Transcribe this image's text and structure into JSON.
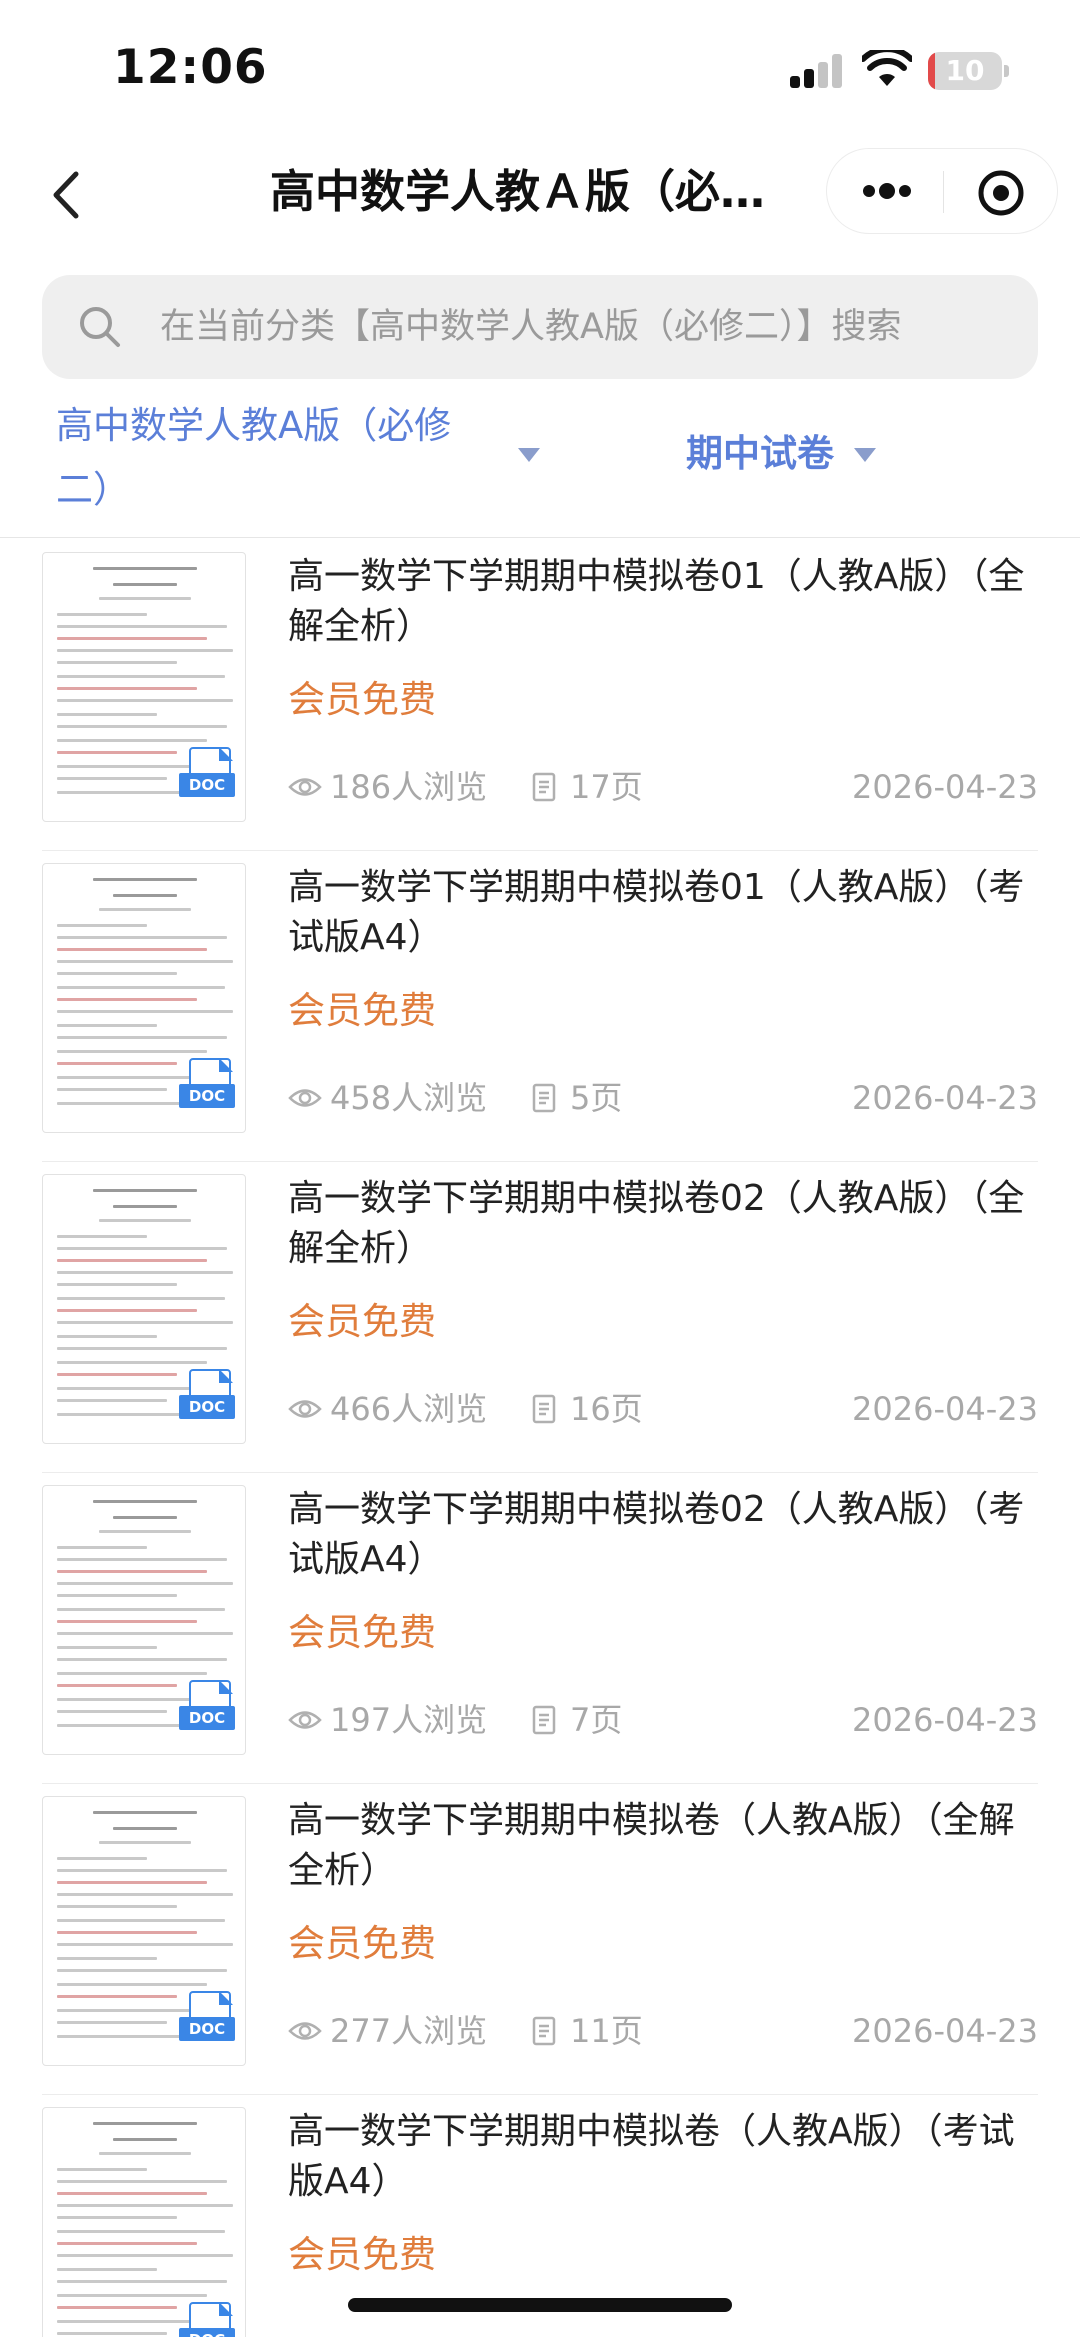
{
  "status_bar": {
    "time": "12:06",
    "battery_label": "10",
    "battery_level": 0.1,
    "battery_color": "#e24a4a"
  },
  "nav": {
    "title": "高中数学人教Ａ版（必…",
    "back_icon": "chevron-left-icon",
    "more_icon": "more-dots-icon",
    "close_icon": "target-circle-icon"
  },
  "search": {
    "placeholder": "在当前分类【高中数学人教A版（必修二）】搜索",
    "icon": "search-icon"
  },
  "filters": {
    "category": "高中数学人教A版（必修二）",
    "type": "期中试卷",
    "accent_color": "#5b7fd8"
  },
  "price_color": "#e07d3c",
  "documents": [
    {
      "title": "高一数学下学期期中模拟卷01（人教A版）（全解全析）",
      "price": "会员免费",
      "views": "186人浏览",
      "pages": "17页",
      "date": "2026-04-23",
      "badge": "DOC"
    },
    {
      "title": "高一数学下学期期中模拟卷01（人教A版）（考试版A4）",
      "price": "会员免费",
      "views": "458人浏览",
      "pages": "5页",
      "date": "2026-04-23",
      "badge": "DOC"
    },
    {
      "title": "高一数学下学期期中模拟卷02（人教A版）（全解全析）",
      "price": "会员免费",
      "views": "466人浏览",
      "pages": "16页",
      "date": "2026-04-23",
      "badge": "DOC"
    },
    {
      "title": "高一数学下学期期中模拟卷02（人教A版）（考试版A4）",
      "price": "会员免费",
      "views": "197人浏览",
      "pages": "7页",
      "date": "2026-04-23",
      "badge": "DOC"
    },
    {
      "title": "高一数学下学期期中模拟卷（人教A版）（全解全析）",
      "price": "会员免费",
      "views": "277人浏览",
      "pages": "11页",
      "date": "2026-04-23",
      "badge": "DOC"
    },
    {
      "title": "高一数学下学期期中模拟卷（人教A版）（考试版A4）",
      "price": "会员免费",
      "views": "",
      "pages": "",
      "date": "",
      "badge": "DOC"
    }
  ]
}
